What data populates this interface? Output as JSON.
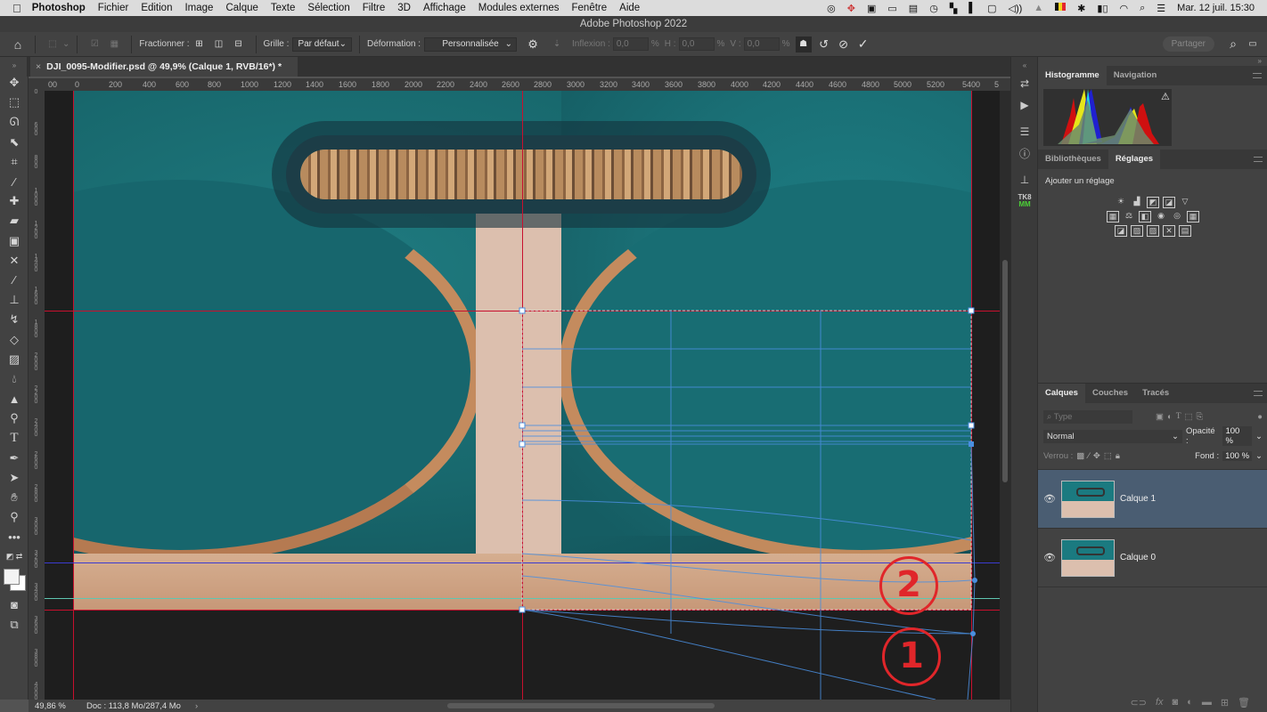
{
  "menubar": {
    "apple": "",
    "app": "Photoshop",
    "items": [
      "Fichier",
      "Edition",
      "Image",
      "Calque",
      "Texte",
      "Sélection",
      "Filtre",
      "3D",
      "Affichage",
      "Modules externes",
      "Fenêtre",
      "Aide"
    ],
    "status_icons": [
      "creative-cloud-icon",
      "dropbox-icon",
      "camera-icon",
      "screen-icon",
      "clipboard-icon",
      "time-machine-icon",
      "binoculars-icon",
      "panel-icon",
      "display-icon",
      "volume-icon",
      "vpn-icon",
      "belgium-flag-icon",
      "bluetooth-icon",
      "battery-icon",
      "wifi-icon",
      "spotlight-icon",
      "control-center-icon"
    ],
    "datetime": "Mar. 12 juil.  15:30"
  },
  "window": {
    "title": "Adobe Photoshop 2022"
  },
  "options": {
    "fractionner_label": "Fractionner :",
    "grille_label": "Grille :",
    "grille_value": "Par défaut",
    "deformation_label": "Déformation :",
    "deformation_value": "Personnalisée",
    "inflexion_label": "Inflexion :",
    "inflexion_value": "0,0",
    "h_label": "H :",
    "h_value": "0,0",
    "v_label": "V :",
    "v_value": "0,0",
    "pct": "%",
    "share_label": "Partager"
  },
  "document": {
    "tab_title": "DJI_0095-Modifier.psd @ 49,9% (Calque 1, RVB/16*) *",
    "close": "×"
  },
  "rulers": {
    "h_ticks": [
      "00",
      "0",
      "200",
      "400",
      "600",
      "800",
      "1000",
      "1200",
      "1400",
      "1600",
      "1800",
      "2000",
      "2200",
      "2400",
      "2600",
      "2800",
      "3000",
      "3200",
      "3400",
      "3600",
      "3800",
      "4000",
      "4200",
      "4400",
      "4600",
      "4800",
      "5000",
      "5200",
      "5400",
      "5"
    ],
    "v_ticks": [
      "0",
      "600",
      "800",
      "1000",
      "1200",
      "1400",
      "1600",
      "1800",
      "2000",
      "2200",
      "2400",
      "2600",
      "2800",
      "3000",
      "3200",
      "3400",
      "3600",
      "3800",
      "4000"
    ]
  },
  "tools": [
    "move",
    "marquee",
    "lasso",
    "object-select",
    "crop",
    "eyedropper",
    "healing",
    "bandage",
    "frame",
    "patch",
    "brush",
    "stamp",
    "history-brush",
    "eraser",
    "gradient",
    "blur",
    "dodge",
    "sharpen",
    "type",
    "pen",
    "path-select",
    "hand",
    "zoom",
    "more"
  ],
  "annotations": [
    "2",
    "1"
  ],
  "status": {
    "zoom": "49,86 %",
    "doc": "Doc : 113,8 Mo/287,4 Mo",
    "arrow": "›"
  },
  "panels": {
    "histogram_tabs": [
      "Histogramme",
      "Navigation"
    ],
    "adjust_tabs": [
      "Bibliothèques",
      "Réglages"
    ],
    "adjust_title": "Ajouter un réglage",
    "adjust_rows": [
      [
        "☀",
        "▟",
        "◩",
        "◪",
        "▽"
      ],
      [
        "▦",
        "⚖",
        "◧",
        "◉",
        "◎",
        "▦"
      ],
      [
        "◪",
        "▨",
        "▨",
        "✕",
        "▤"
      ]
    ],
    "layers_tabs": [
      "Calques",
      "Couches",
      "Tracés"
    ],
    "filter_placeholder": "Type",
    "blend_mode": "Normal",
    "opacity_label": "Opacité :",
    "opacity_value": "100 %",
    "lock_label": "Verrou :",
    "fill_label": "Fond :",
    "fill_value": "100 %",
    "layers": [
      {
        "name": "Calque 1",
        "selected": true
      },
      {
        "name": "Calque 0",
        "selected": false
      }
    ]
  },
  "colors": {
    "guide_red": "#c8102e",
    "guide_blue": "#3b3bd0",
    "guide_cyan": "#5fc7b2",
    "warp": "#4a8fe0",
    "annotation": "#e0262a",
    "selected_layer": "#4a5d72"
  }
}
